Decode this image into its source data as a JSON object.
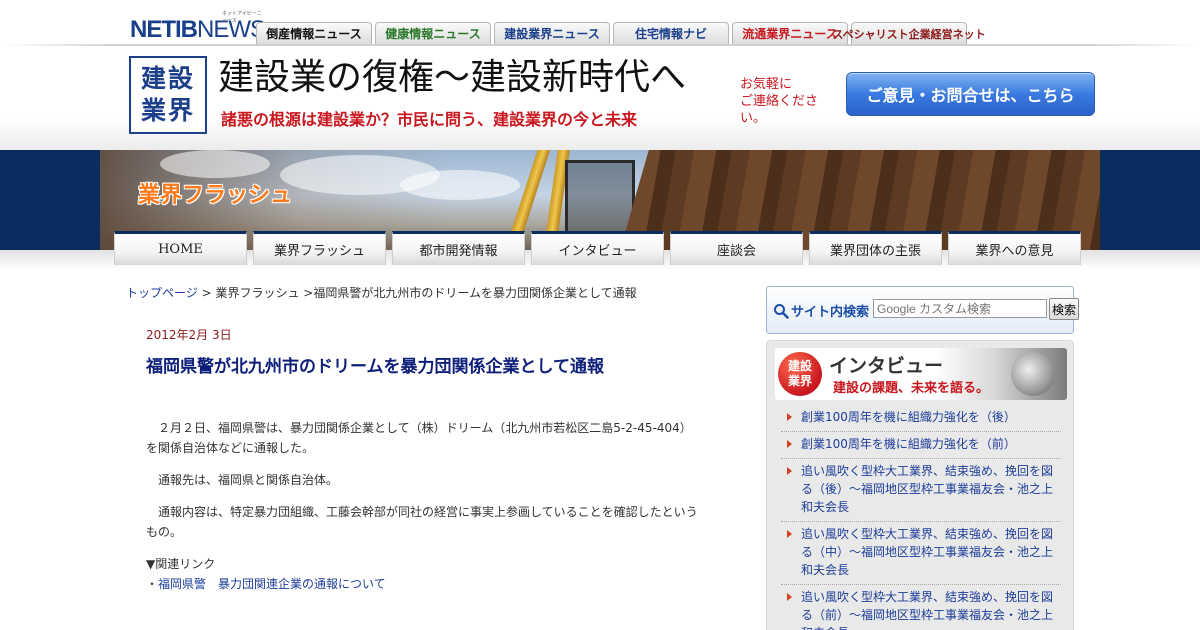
{
  "logo": {
    "main": "NETIB",
    "sub": "NEWS",
    "tiny": "ネットアイビーニュース"
  },
  "top_tabs": [
    {
      "label": "倒産情報ニュース",
      "color": "#111111"
    },
    {
      "label": "健康情報ニュース",
      "color": "#2b7a2b"
    },
    {
      "label": "建設業界ニュース",
      "color": "#1c3f8c"
    },
    {
      "label": "住宅情報ナビ",
      "color": "#1c3f8c"
    },
    {
      "label": "流通業界ニュース",
      "color": "#c8171e"
    },
    {
      "label": "スペシャリスト企業経営ネット",
      "color": "#8b1a1a"
    }
  ],
  "header": {
    "badge_line1": "建設",
    "badge_line2": "業界",
    "title": "建設業の復権～建設新時代へ",
    "subtitle": "諸悪の根源は建設業か？市民に問う、建設業界の今と未来",
    "contact_note_line1": "お気軽に",
    "contact_note_line2": "ご連絡ください。",
    "contact_button": "ご意見・お問合せは、こちら"
  },
  "hero": {
    "label": "業界フラッシュ"
  },
  "nav": [
    "HOME",
    "業界フラッシュ",
    "都市開発情報",
    "インタビュー",
    "座談会",
    "業界団体の主張",
    "業界への意見"
  ],
  "breadcrumb": {
    "home": "トップページ",
    "sep1": " > ",
    "section": "業界フラッシュ",
    "sep2": " >",
    "current": "福岡県警が北九州市のドリームを暴力団関係企業として通報"
  },
  "article": {
    "date": "2012年2月 3日",
    "title": "福岡県警が北九州市のドリームを暴力団関係企業として通報",
    "paragraphs": [
      "２月２日、福岡県警は、暴力団関係企業として（株）ドリーム（北九州市若松区二島5-2-45-404）を関係自治体などに通報した。",
      "通報先は、福岡県と関係自治体。",
      "通報内容は、特定暴力団組織、工藤会幹部が同社の経営に事実上参画していることを確認したというもの。"
    ],
    "related_heading": "▼関連リンク",
    "related_prefix": "・",
    "related_link": "福岡県警　暴力団関連企業の通報について"
  },
  "search": {
    "label": "サイト内検索",
    "placeholder": "Google カスタム検索",
    "button": "検索"
  },
  "interview": {
    "badge_line1": "建設",
    "badge_line2": "業界",
    "title": "インタビュー",
    "subtitle": "建設の課題、未来を語る。",
    "items": [
      "創業100周年を機に組織力強化を（後）",
      "創業100周年を機に組織力強化を（前）",
      "追い風吹く型枠大工業界、結束強め、挽回を図る（後）～福岡地区型枠工事業福友会・池之上和夫会長",
      "追い風吹く型枠大工業界、結束強め、挽回を図る（中）～福岡地区型枠工事業福友会・池之上和夫会長",
      "追い風吹く型枠大工業界、結束強め、挽回を図る（前）～福岡地区型枠工事業福友会・池之上和夫会長"
    ]
  },
  "colors": {
    "brand_blue": "#1c3f8c",
    "accent_red": "#c8171e",
    "navy_band": "#0b2c5f",
    "link_blue": "#1d3d99"
  }
}
